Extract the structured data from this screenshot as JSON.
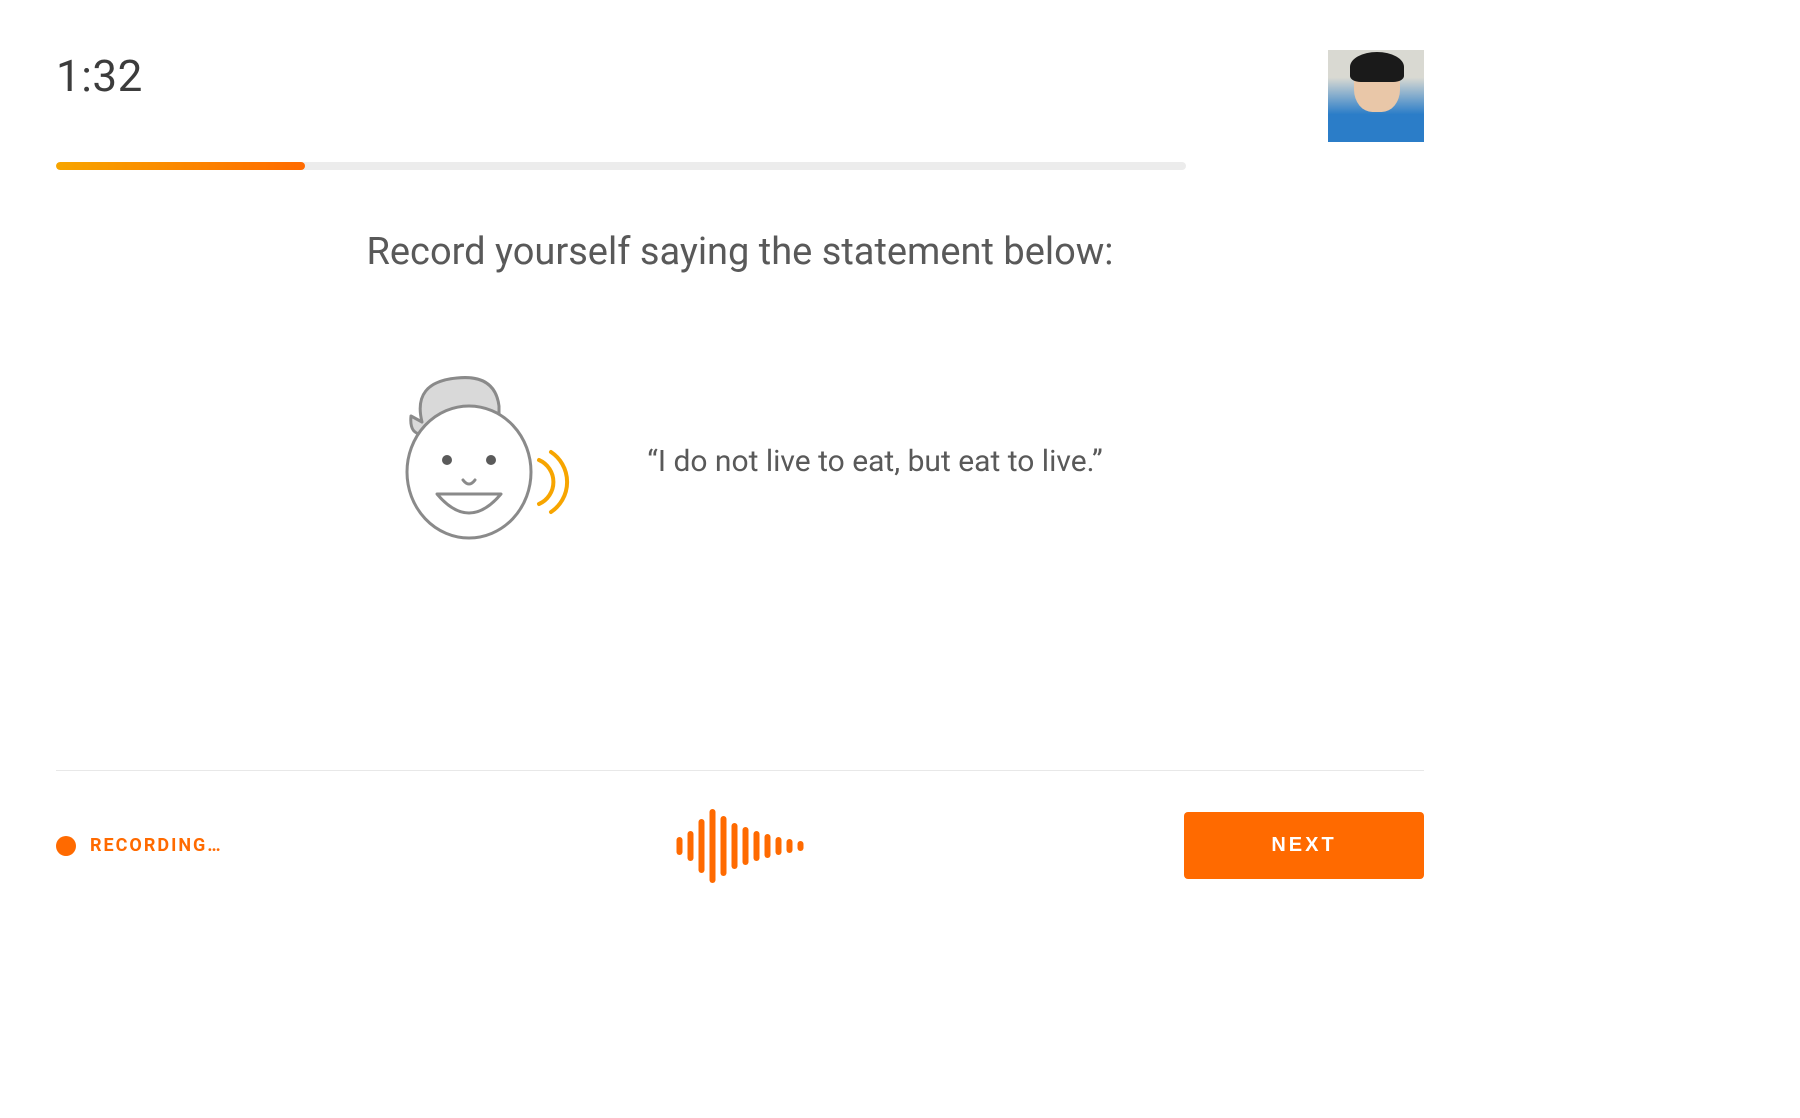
{
  "header": {
    "timer": "1:32",
    "progress_percent": 22
  },
  "main": {
    "instruction": "Record yourself saying the statement below:",
    "prompt": "“I do not live to eat, but eat to live.”"
  },
  "footer": {
    "status_label": "RECORDING…",
    "next_label": "NEXT"
  },
  "colors": {
    "accent": "#ff6a00",
    "accent_light": "#f7a500",
    "text": "#595959"
  },
  "icons": {
    "face": "speaking-face-icon",
    "record": "record-dot-icon",
    "waveform": "audio-waveform-icon",
    "avatar": "user-avatar"
  }
}
